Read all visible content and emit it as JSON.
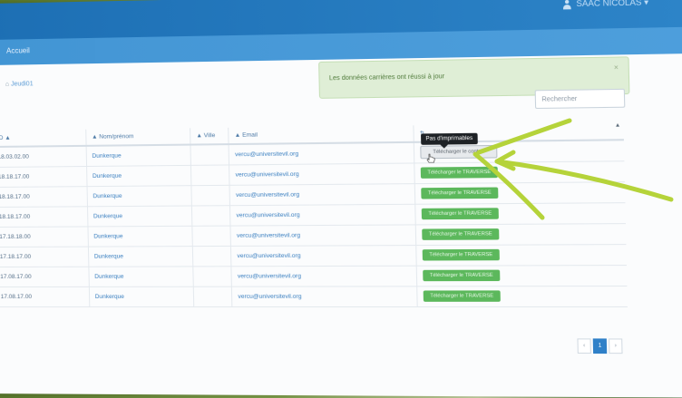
{
  "header": {
    "user_label": "SAAC NICOLAS ▾"
  },
  "subbar": {
    "brand": "Accueil"
  },
  "breadcrumb": {
    "home": "⌂",
    "current": "Jeudi01"
  },
  "alert": {
    "message": "Les données carrières ont réussi à jour",
    "close": "×"
  },
  "search": {
    "placeholder": "Rechercher"
  },
  "table": {
    "headers": {
      "id": "ID ▲",
      "name": "▲ Nom/prénom",
      "city": "▲ Ville",
      "email": "▲ Email",
      "action": "⇅"
    },
    "rows": [
      {
        "id": "18.03.02.00",
        "name": "Dunkerque",
        "email": "vercu@universitevil.org",
        "action": "Télécharger le contrat"
      },
      {
        "id": "18.18.17.00",
        "name": "Dunkerque",
        "email": "vercu@universitevil.org",
        "action": "Télécharger le TRAVERSE"
      },
      {
        "id": "18.18.17.00",
        "name": "Dunkerque",
        "email": "vercu@universitevil.org",
        "action": "Télécharger le TRAVERSE"
      },
      {
        "id": "18.18.17.00",
        "name": "Dunkerque",
        "email": "vercu@universitevil.org",
        "action": "Télécharger le TRAVERSE"
      },
      {
        "id": "17.18.18.00",
        "name": "Dunkerque",
        "email": "vercu@universitevil.org",
        "action": "Télécharger le TRAVERSE"
      },
      {
        "id": "17.18.17.00",
        "name": "Dunkerque",
        "email": "vercu@universitevil.org",
        "action": "Télécharger le TRAVERSE"
      },
      {
        "id": "17.08.17.00",
        "name": "Dunkerque",
        "email": "vercu@universitevil.org",
        "action": "Télécharger le TRAVERSE"
      },
      {
        "id": "17.08.17.00",
        "name": "Dunkerque",
        "email": "vercu@universitevil.org",
        "action": "Télécharger le TRAVERSE"
      }
    ]
  },
  "tooltip": {
    "text": "Pas d'imprimables"
  },
  "pager": {
    "prev": "‹",
    "current": "1",
    "next": "›"
  },
  "colors": {
    "topbar": "#1d6fb4",
    "alert_bg": "#dfeed6",
    "download_button": "#5cb85c",
    "annotation_arrow": "#b5d33a"
  }
}
